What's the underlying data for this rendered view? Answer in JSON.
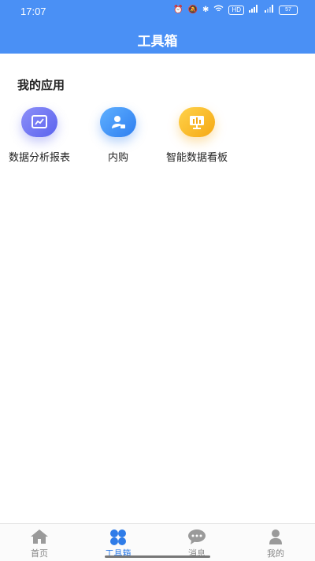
{
  "status_bar": {
    "time": "17:07",
    "icons": [
      "alarm-icon",
      "mute-icon",
      "bluetooth-icon",
      "wifi-icon",
      "hd-icon",
      "signal-icon",
      "signal-icon-2",
      "battery-icon"
    ],
    "hd_label": "HD",
    "battery_level": "57"
  },
  "header": {
    "title": "工具箱"
  },
  "section": {
    "title": "我的应用"
  },
  "apps": [
    {
      "label": "数据分析报表",
      "icon": "chart-report-icon",
      "color": "#6b72f2"
    },
    {
      "label": "内购",
      "icon": "user-purchase-icon",
      "color": "#3d8ff0"
    },
    {
      "label": "智能数据看板",
      "icon": "dashboard-screen-icon",
      "color": "#f5b81d"
    }
  ],
  "tabs": [
    {
      "label": "首页",
      "icon": "home-icon",
      "active": false
    },
    {
      "label": "工具箱",
      "icon": "toolbox-icon",
      "active": true
    },
    {
      "label": "消息",
      "icon": "message-icon",
      "active": false
    },
    {
      "label": "我的",
      "icon": "profile-icon",
      "active": false
    }
  ],
  "colors": {
    "primary": "#4a90f5",
    "active_tab": "#2f7ce8",
    "inactive_tab": "#9a9a9a"
  }
}
